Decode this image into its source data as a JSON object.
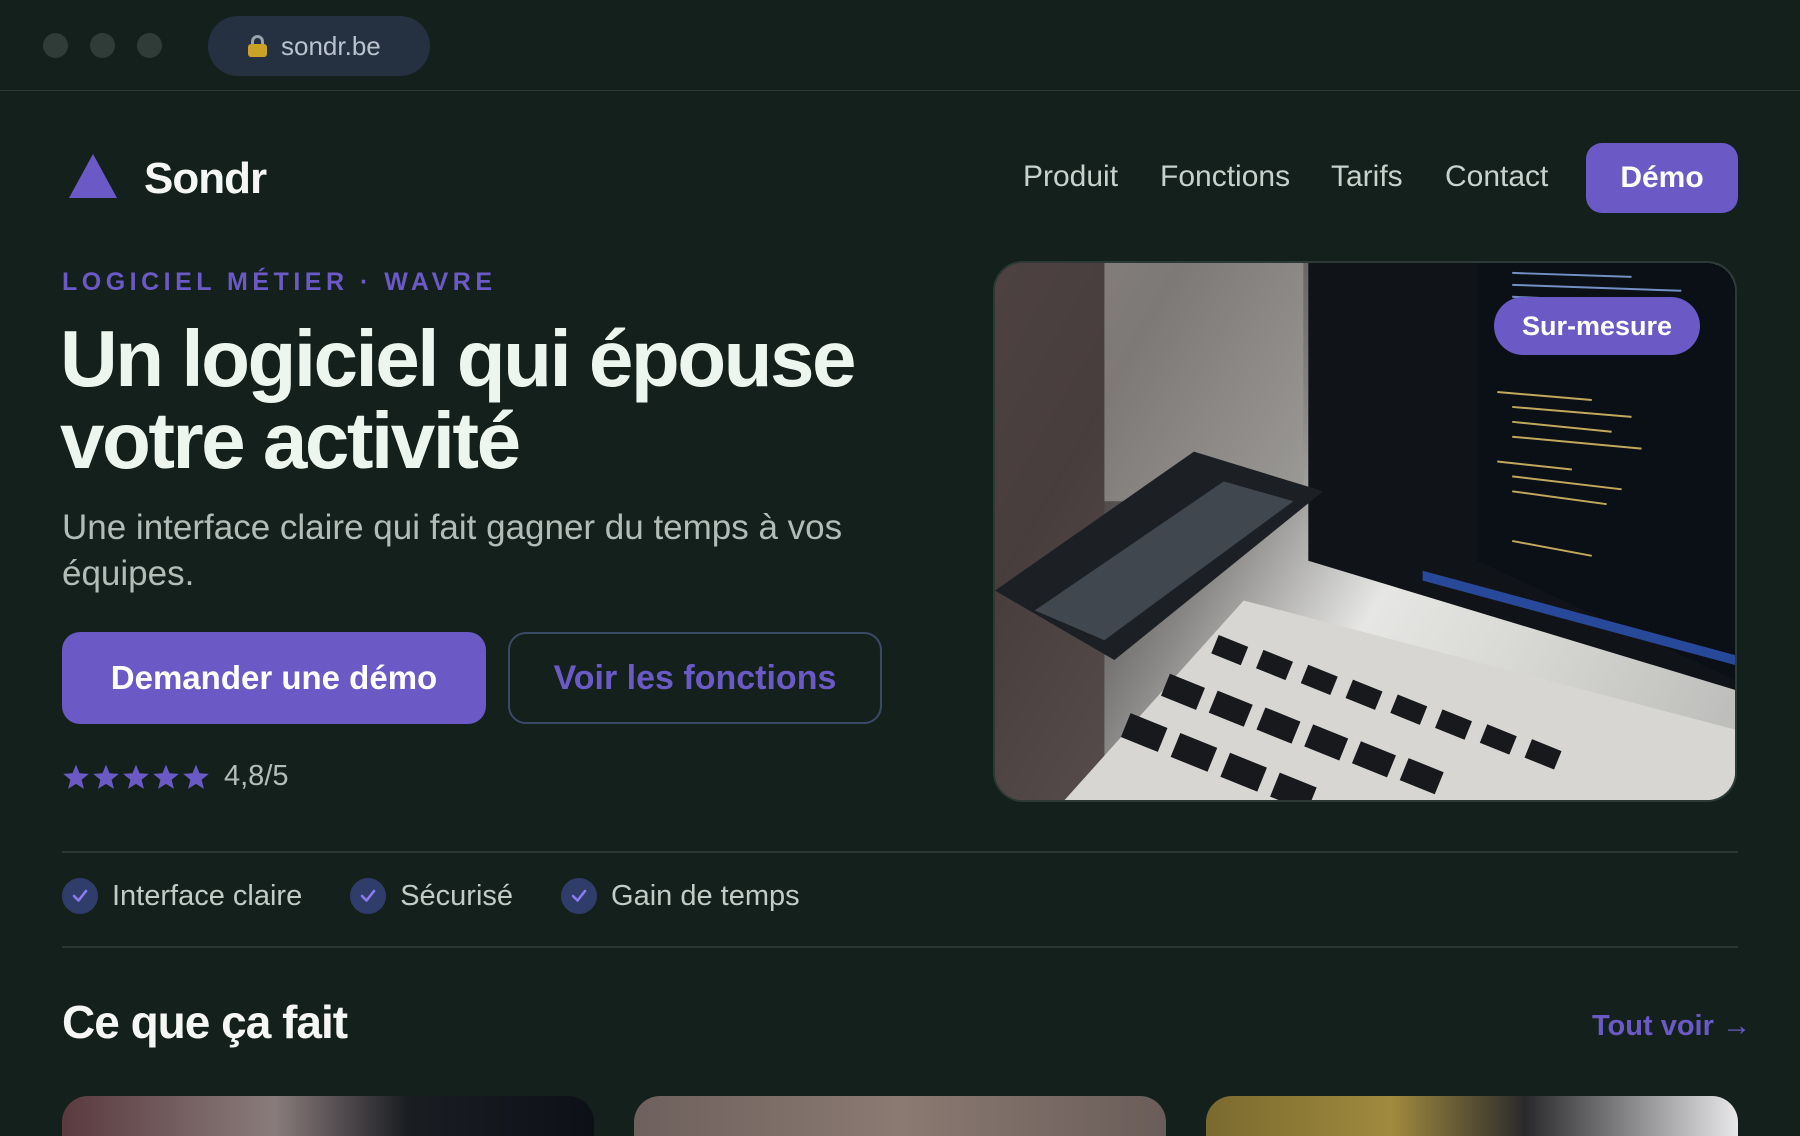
{
  "browser": {
    "url": "sondr.be",
    "traffic_lights": [
      "close",
      "minimize",
      "maximize"
    ]
  },
  "nav": {
    "logo_text": "Sondr",
    "links": [
      "Produit",
      "Fonctions",
      "Tarifs",
      "Contact"
    ],
    "cta_label": "Démo"
  },
  "hero": {
    "eyebrow": "LOGICIEL MÉTIER · WAVRE",
    "title": "Un logiciel qui épouse votre activité",
    "subtitle": "Une interface claire qui fait gagner du temps à vos équipes.",
    "primary_button": "Demander une démo",
    "secondary_button": "Voir les fonctions",
    "rating": {
      "stars": 5,
      "value": "4,8/5"
    },
    "image_badge": "Sur-mesure"
  },
  "features": [
    "Interface claire",
    "Sécurisé",
    "Gain de temps"
  ],
  "section": {
    "title": "Ce que ça fait",
    "see_all": "Tout voir →"
  },
  "colors": {
    "background": "#14201c",
    "accent": "#6b5ac6",
    "heading": "#edf6ee",
    "muted_text": "#b2bdb7"
  }
}
